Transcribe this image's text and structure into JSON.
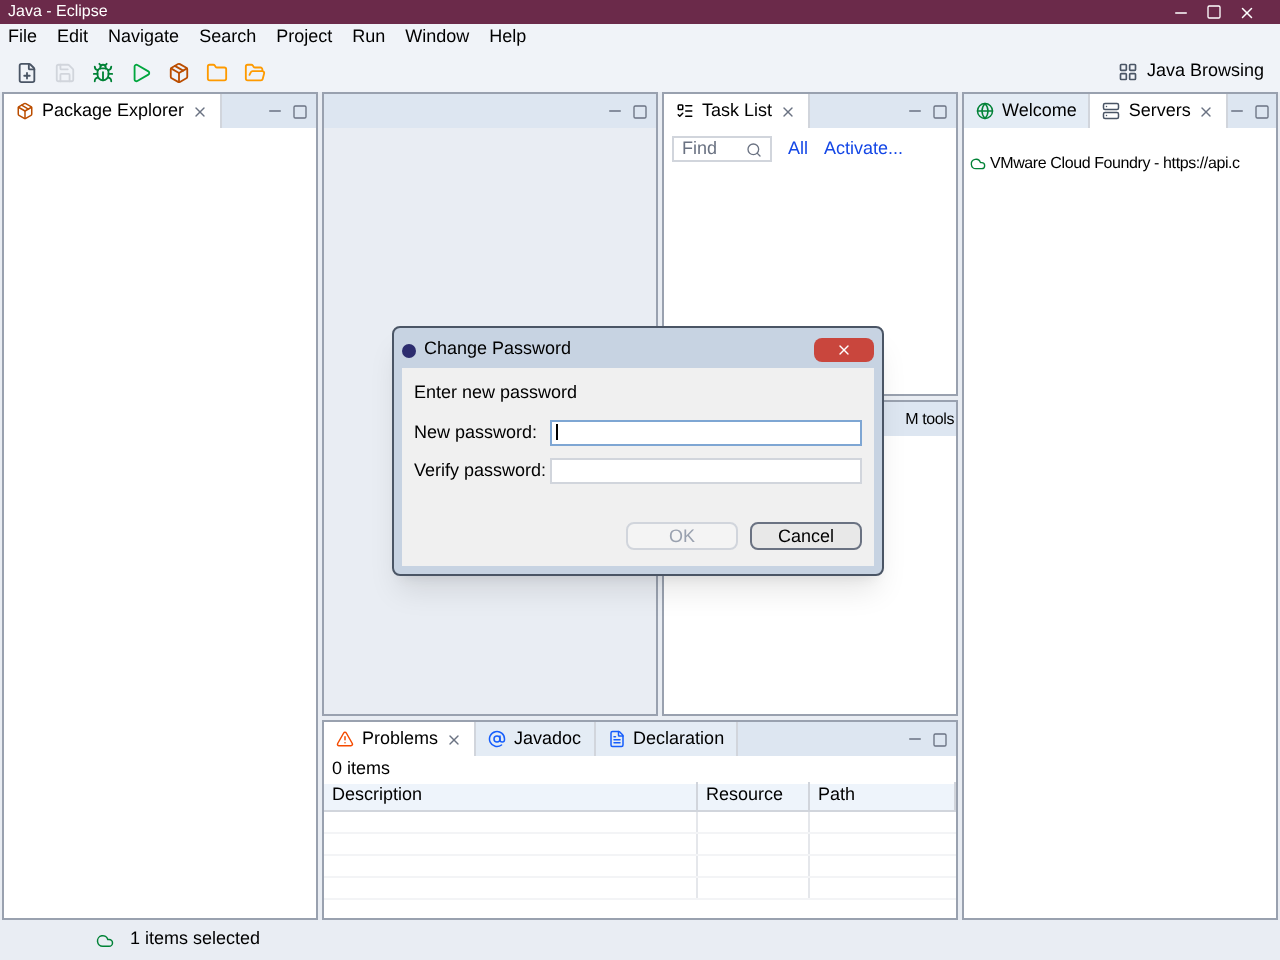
{
  "window": {
    "title": "Java - Eclipse"
  },
  "menu": [
    "File",
    "Edit",
    "Navigate",
    "Search",
    "Project",
    "Run",
    "Window",
    "Help"
  ],
  "toolbar": {
    "perspective": "Java Browsing"
  },
  "package_explorer": {
    "tab": "Package Explorer"
  },
  "task_list": {
    "tab": "Task List",
    "find_placeholder": "Find",
    "links": [
      "All",
      "Activate..."
    ]
  },
  "hidden_panel": {
    "text": "M tools"
  },
  "right_tabs": [
    {
      "label": "Welcome",
      "selected": false
    },
    {
      "label": "Servers",
      "selected": true
    }
  ],
  "servers": [
    "VMware Cloud Foundry - https://api.c"
  ],
  "bottom_tabs": [
    {
      "label": "Problems",
      "selected": true
    },
    {
      "label": "Javadoc",
      "selected": false
    },
    {
      "label": "Declaration",
      "selected": false
    }
  ],
  "problems": {
    "count": "0 items",
    "columns": [
      "Description",
      "Resource",
      "Path"
    ]
  },
  "status_bar": {
    "text": "1 items selected"
  },
  "dialog": {
    "title": "Change Password",
    "heading": "Enter new password",
    "fields": [
      {
        "label": "New password:",
        "focused": true
      },
      {
        "label": "Verify password:",
        "focused": false
      }
    ],
    "buttons": [
      {
        "label": "OK",
        "disabled": true
      },
      {
        "label": "Cancel",
        "disabled": false
      }
    ]
  }
}
